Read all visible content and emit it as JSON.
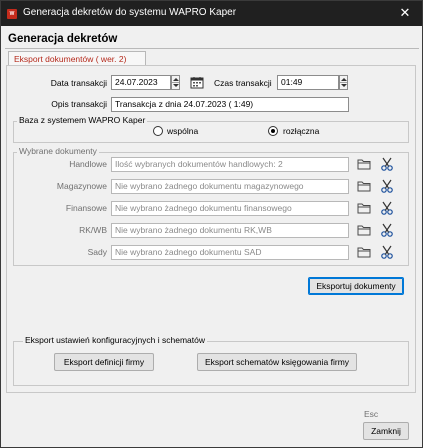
{
  "window": {
    "title": "Generacja dekretów do systemu WAPRO Kaper",
    "app_icon": "wapro-app-icon",
    "close_glyph": "✕"
  },
  "page": {
    "heading": "Generacja dekretów"
  },
  "tab": {
    "label": "Eksport dokumentów ( wer. 2)"
  },
  "transaction": {
    "date_label": "Data transakcji",
    "date_value": "24.07.2023",
    "time_label": "Czas transakcji",
    "time_value": "01:49",
    "description_label": "Opis transakcji",
    "description_value": "Transakcja z dnia 24.07.2023 ( 1:49)"
  },
  "database": {
    "group_title": "Baza z systemem WAPRO Kaper",
    "option_shared": "wspólna",
    "option_separate": "rozłączna",
    "selected": "rozłączna"
  },
  "documents": {
    "group_title": "Wybrane dokumenty",
    "rows": [
      {
        "label": "Handlowe",
        "value": "Ilość wybranych dokumentów handlowych: 2"
      },
      {
        "label": "Magazynowe",
        "value": "Nie wybrano żadnego dokumentu magazynowego"
      },
      {
        "label": "Finansowe",
        "value": "Nie wybrano żadnego dokumentu finansowego"
      },
      {
        "label": "RK/WB",
        "value": "Nie wybrano żadnego dokumentu RK,WB"
      },
      {
        "label": "Sady",
        "value": "Nie wybrano żadnego dokumentu SAD"
      }
    ]
  },
  "export_button": "Eksportuj dokumenty",
  "config_export": {
    "group_title": "Eksport ustawień konfiguracyjnych i schematów",
    "definitions_button": "Eksport definicji firmy",
    "schemes_button": "Eksport schematów księgowania firmy"
  },
  "footer": {
    "esc_hint": "Esc",
    "close_button": "Zamknij"
  },
  "colors": {
    "title_bar": "#202020",
    "tab_text": "#b52a1c",
    "accent_border": "#0078d7",
    "folder_icon": "#4a4a4a",
    "scissors_icon": "#1a4f9c"
  }
}
